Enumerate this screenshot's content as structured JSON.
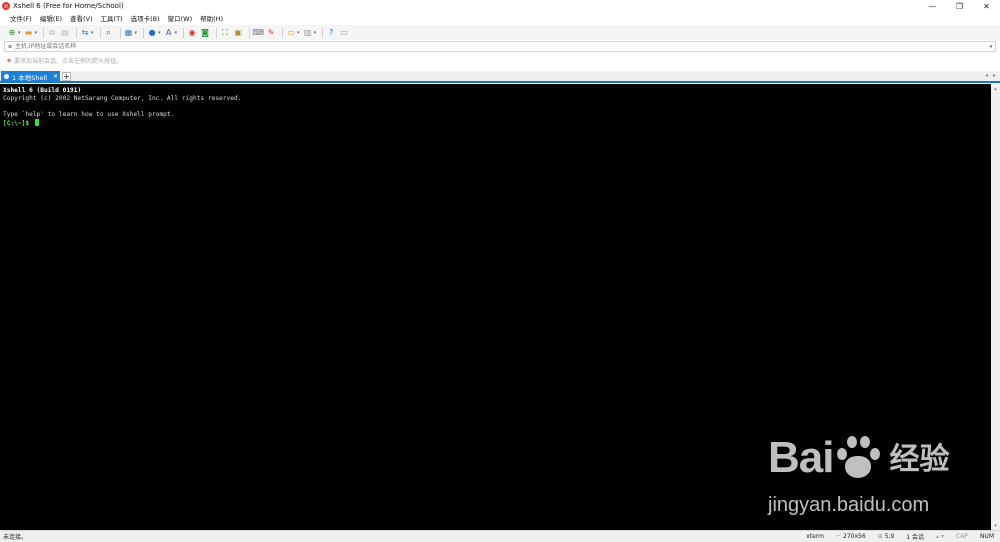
{
  "window": {
    "title": "Xshell 6 (Free for Home/School)",
    "controls": {
      "minimize": "—",
      "restore": "❐",
      "close": "✕"
    }
  },
  "menu": [
    {
      "label": "文件(F)"
    },
    {
      "label": "编辑(E)"
    },
    {
      "label": "查看(V)"
    },
    {
      "label": "工具(T)"
    },
    {
      "label": "选项卡(B)"
    },
    {
      "label": "窗口(W)"
    },
    {
      "label": "帮助(H)"
    }
  ],
  "toolbar": {
    "icons": [
      "new-session-icon",
      "open-folder-icon",
      "copy-icon",
      "paste-icon",
      "transfer-icon",
      "find-icon",
      "properties-icon",
      "globe-icon",
      "font-icon",
      "xftp-icon",
      "xshell-icon",
      "fullscreen-icon",
      "lock-icon",
      "keyboard-icon",
      "highlight-icon",
      "script-icon",
      "layout-icon",
      "help-icon",
      "chat-icon"
    ]
  },
  "address_bar": {
    "placeholder": "主机,IP地址或会话名称"
  },
  "quick_bar": {
    "text": "要添加当前会话，点击左侧的箭头按钮。"
  },
  "tabs": [
    {
      "label": "1 本地Shell",
      "active": true
    }
  ],
  "tab_add_label": "+",
  "terminal": {
    "lines": [
      {
        "text": "Xshell 6 (Build 0191)",
        "bold": true
      },
      {
        "text": "Copyright (c) 2002 NetSarang Computer, Inc. All rights reserved.",
        "bold": false
      },
      {
        "text": "",
        "bold": false
      },
      {
        "text": "Type `help' to learn how to use Xshell prompt.",
        "bold": false
      }
    ],
    "prompt": "[C:\\~]$ ",
    "background": "#000000",
    "cursor_color": "#2ee82e"
  },
  "watermark": {
    "brand_text": "Bai",
    "brand_tail": "经验",
    "url": "jingyan.baidu.com"
  },
  "status": {
    "left": "未连接。",
    "terminal_type": "xterm",
    "size": "270x56",
    "position": "5,9",
    "sessions": "1 会话",
    "caps": "CAP",
    "num": "NUM"
  },
  "colors": {
    "tab_active": "#1e7fd6",
    "tab_underline": "#1a73c9",
    "app_icon": "#e03a2f"
  }
}
